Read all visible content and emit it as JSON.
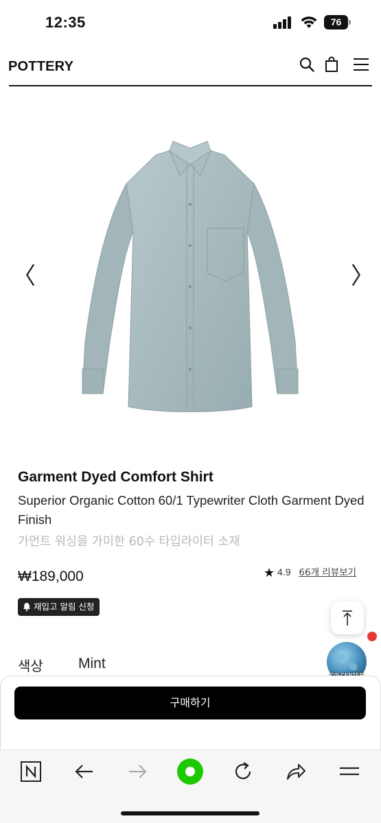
{
  "status_bar": {
    "time": "12:35",
    "battery": "76"
  },
  "header": {
    "logo": "POTTERY",
    "icons": [
      "search-icon",
      "shopping-bag-icon",
      "menu-icon"
    ]
  },
  "gallery": {
    "prev": "〈",
    "next": "〉",
    "image": "mint-shirt-image"
  },
  "product": {
    "title": "Garment Dyed Comfort Shirt",
    "description": "Superior Organic Cotton 60/1 Typewriter Cloth Garment Dyed Finish",
    "description_ko": "가먼트 워싱을 가미한 60수 타입라이터 소재",
    "price": "₩189,000",
    "rating": "4.9",
    "review_link": "66개 리뷰보기",
    "restock_button": "재입고 알림 신청"
  },
  "floating": {
    "cs_label": "C/S CENTER"
  },
  "options": {
    "color_label": "색상",
    "color_value": "Mint"
  },
  "buy": {
    "label": "구매하기"
  },
  "browser_toolbar": {
    "items": [
      "naver-n-icon",
      "back-icon",
      "forward-icon",
      "green-home-icon",
      "reload-icon",
      "share-icon",
      "menu-icon"
    ]
  },
  "colors": {
    "accent_green": "#1ec800",
    "shirt": "#a9bcc0",
    "button": "#000000",
    "badge_red": "#e53935"
  }
}
